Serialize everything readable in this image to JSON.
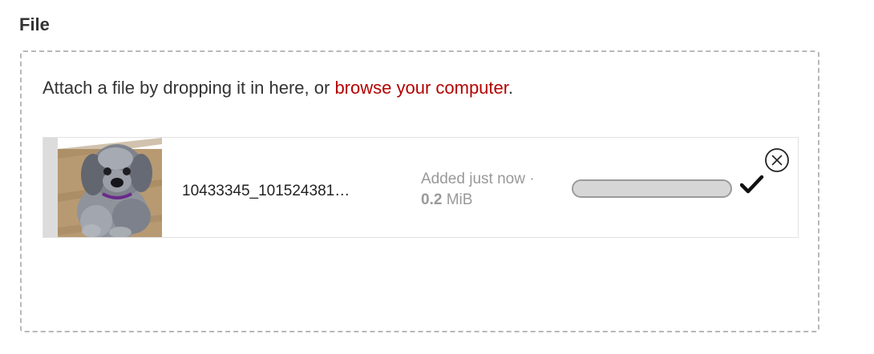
{
  "field": {
    "label": "File"
  },
  "dropzone": {
    "instruction_prefix": "Attach a file by dropping it in here, or ",
    "browse_link": "browse your computer",
    "instruction_suffix": "."
  },
  "files": [
    {
      "name": "10433345_101524381…",
      "added": "Added just now ·",
      "size_value": "0.2",
      "size_unit": " MiB",
      "progress": 1.0,
      "status_icon": "checkmark-icon",
      "remove_icon": "close-circle-icon",
      "thumbnail_icon": "dog-photo-thumbnail"
    }
  ],
  "colors": {
    "link": "#b40000",
    "border": "#b8b8b8",
    "progress": "#d6d6d6"
  }
}
